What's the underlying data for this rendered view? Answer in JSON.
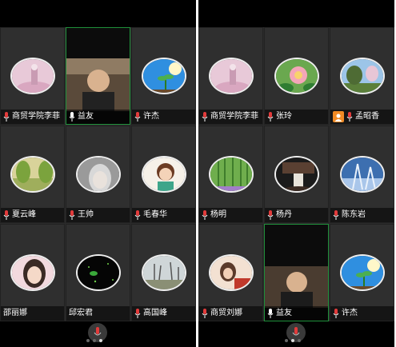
{
  "left_screen": {
    "participants": [
      {
        "name": "商贸学院李菲"
      },
      {
        "name": "益友"
      },
      {
        "name": "许杰"
      },
      {
        "name": "夏云峰"
      },
      {
        "name": "王帅"
      },
      {
        "name": "毛春华"
      },
      {
        "name": "邵丽娜"
      },
      {
        "name": "邱宏君"
      },
      {
        "name": "高国峰"
      }
    ],
    "page_indicator": {
      "pages": 3,
      "current": 3
    }
  },
  "right_screen": {
    "participants": [
      {
        "name": "商贸学院李菲"
      },
      {
        "name": "张玲"
      },
      {
        "name": "孟昭香"
      },
      {
        "name": "杨明"
      },
      {
        "name": "杨丹"
      },
      {
        "name": "陈东岩"
      },
      {
        "name": "商贸刘娜"
      },
      {
        "name": "益友"
      },
      {
        "name": "许杰"
      }
    ],
    "page_indicator": {
      "pages": 3,
      "current": 2
    }
  },
  "colors": {
    "accent_green": "#1f8f3a",
    "mic_red": "#e23b3b",
    "host_orange": "#f08a24"
  }
}
